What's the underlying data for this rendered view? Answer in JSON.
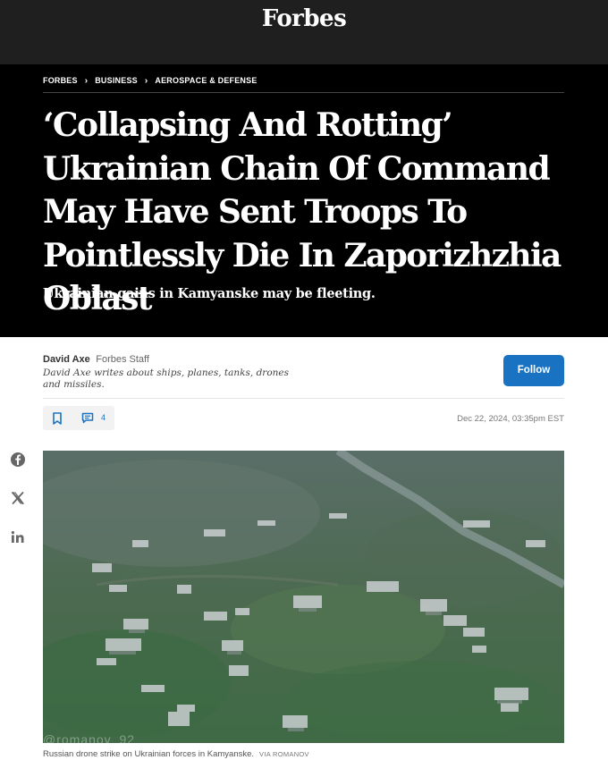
{
  "header": {
    "logo": "Forbes"
  },
  "breadcrumb": {
    "items": [
      "FORBES",
      "BUSINESS",
      "AEROSPACE & DEFENSE"
    ]
  },
  "article": {
    "headline": "‘Collapsing And Rotting’ Ukrainian Chain Of Command May Have Sent Troops To Pointlessly Die In Zaporizhzhia Oblast",
    "dek": "Ukrainian gains in Kamyanske may be fleeting.",
    "date": "Dec 22, 2024, 03:35pm EST",
    "comment_count": "4"
  },
  "author": {
    "name": "David Axe",
    "role": "Forbes Staff",
    "bio": "David Axe writes about ships, planes, tanks, drones and missiles.",
    "follow_label": "Follow"
  },
  "share": {
    "icons": [
      "facebook-icon",
      "x-icon",
      "linkedin-icon"
    ]
  },
  "photo": {
    "watermark": "@romanov_92",
    "caption": "Russian drone strike on Ukrainian forces in Kamyanske.",
    "credit": "VIA ROMANOV"
  },
  "colors": {
    "accent": "#1a73c2",
    "topbar": "#1f1f1f",
    "hero": "#000000"
  }
}
